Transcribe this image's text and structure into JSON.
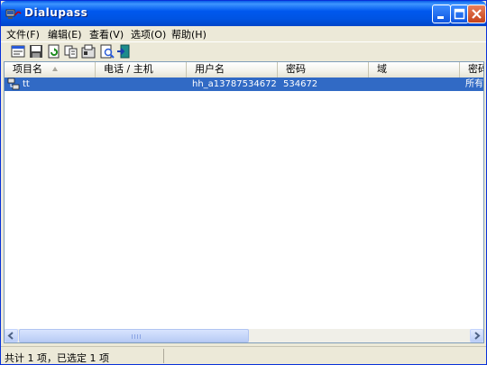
{
  "window": {
    "title": "Dialupass"
  },
  "menu": [
    {
      "label": "文件(F)"
    },
    {
      "label": "编辑(E)"
    },
    {
      "label": "查看(V)"
    },
    {
      "label": "选项(O)"
    },
    {
      "label": "帮助(H)"
    }
  ],
  "toolbar": {
    "buttons": [
      {
        "icon": "properties-icon"
      },
      {
        "icon": "save-icon"
      },
      {
        "icon": "refresh-icon"
      },
      {
        "icon": "copy-icon"
      },
      {
        "icon": "options-icon"
      },
      {
        "icon": "find-icon"
      },
      {
        "icon": "exit-icon"
      }
    ]
  },
  "list": {
    "columns": [
      "项目名",
      "电话 / 主机",
      "用户名",
      "密码",
      "域",
      "密码"
    ],
    "rows": [
      {
        "name": "tt",
        "phone": "",
        "user": "hh_a13787534672",
        "password": "534672",
        "domain": "",
        "saved": "所有"
      }
    ]
  },
  "status": {
    "text": "共计 1 项，已选定 1 项"
  },
  "colors": {
    "titlebar": "#0054e3",
    "selection": "#316ac5",
    "face": "#ece9d8"
  }
}
